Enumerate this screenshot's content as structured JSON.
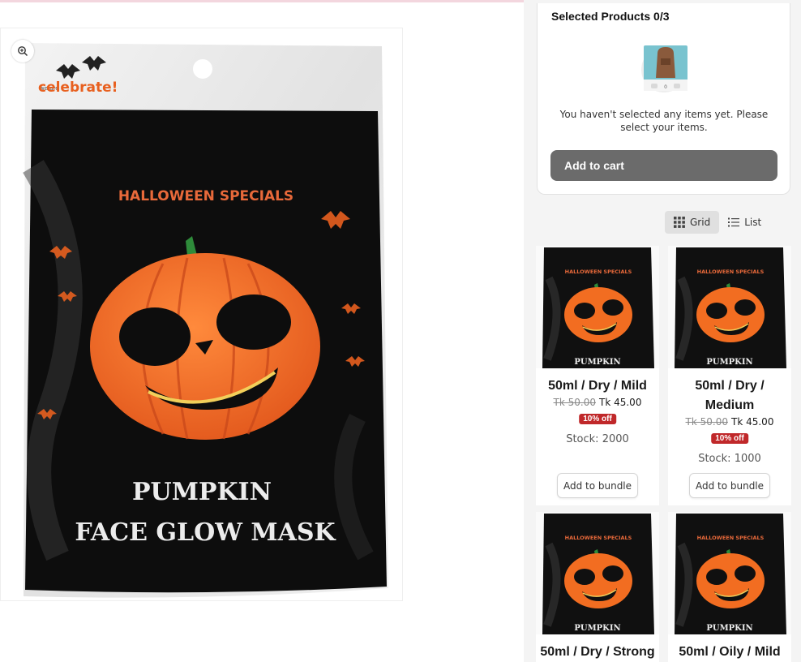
{
  "bundle": {
    "selected_title": "Selected Products 0/3",
    "empty_message": "You haven't selected any items yet. Please select your items.",
    "add_to_cart_label": "Add to cart",
    "illustration_counter": "0"
  },
  "view_toggle": {
    "grid_label": "Grid",
    "list_label": "List",
    "active": "grid"
  },
  "main_image": {
    "brand": "celebrate!",
    "brand_small": "we are",
    "banner": "HALLOWEEN SPECIALS",
    "title_line1": "PUMPKIN",
    "title_line2": "FACE GLOW MASK"
  },
  "products": [
    {
      "name": "50ml / Dry / Mild",
      "old_price": "Tk 50.00",
      "price": "Tk 45.00",
      "badge": "10% off",
      "stock": "Stock: 2000",
      "button": "Add to bundle",
      "thumb_label": "PUMPKIN",
      "thumb_banner": "HALLOWEEN SPECIALS"
    },
    {
      "name": "50ml / Dry / Medium",
      "old_price": "Tk 50.00",
      "price": "Tk 45.00",
      "badge": "10% off",
      "stock": "Stock: 1000",
      "button": "Add to bundle",
      "thumb_label": "PUMPKIN",
      "thumb_banner": "HALLOWEEN SPECIALS"
    },
    {
      "name": "50ml / Dry / Strong",
      "thumb_label": "PUMPKIN",
      "thumb_banner": "HALLOWEEN SPECIALS"
    },
    {
      "name": "50ml / Oily / Mild",
      "thumb_label": "PUMPKIN",
      "thumb_banner": "HALLOWEEN SPECIALS"
    }
  ],
  "colors": {
    "pumpkin": "#f26d21",
    "stem": "#2e8b3a",
    "badge_red": "#c0282a",
    "package_black": "#0d0d0d",
    "cart_button": "#6b6b6b"
  }
}
